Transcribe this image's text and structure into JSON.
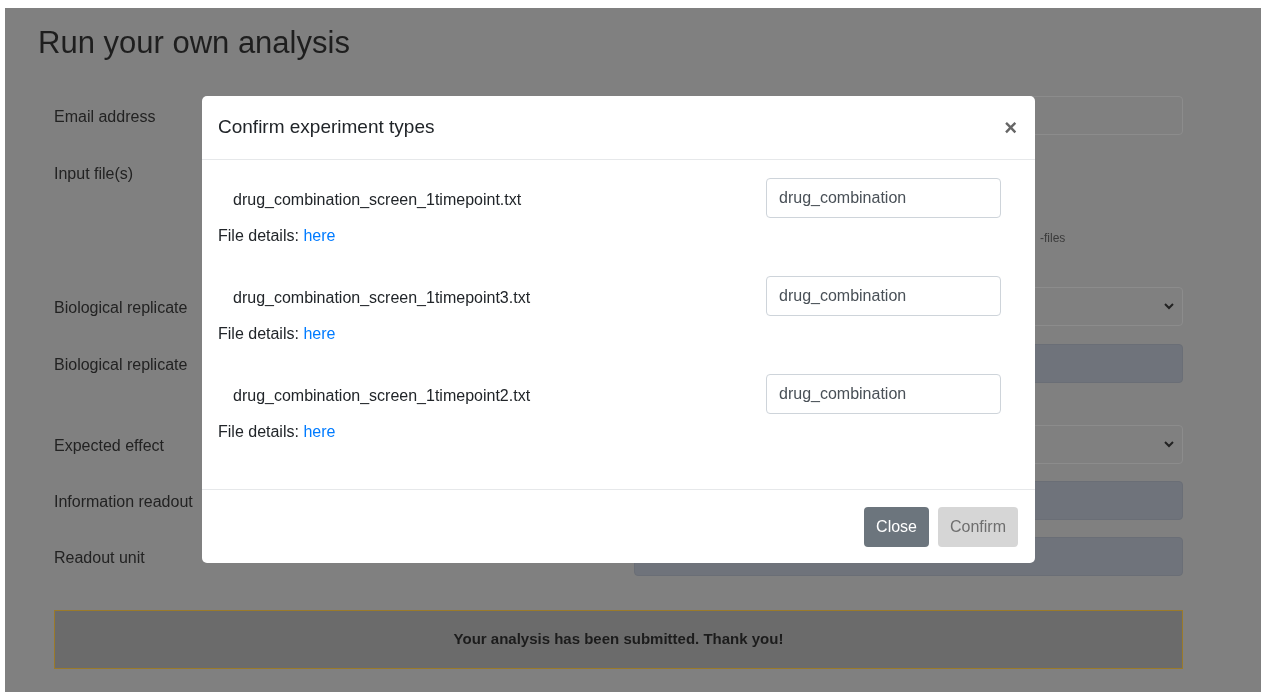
{
  "page": {
    "title": "Run your own analysis",
    "fields": [
      {
        "label": "Email address",
        "kind": "text",
        "disabled": false
      },
      {
        "label": "Input file(s)",
        "kind": "file",
        "note": "-files"
      },
      {
        "label": "Biological replicate",
        "kind": "select",
        "disabled": false
      },
      {
        "label": "Biological replicate",
        "kind": "text",
        "disabled": true
      },
      {
        "label": "Expected effect",
        "kind": "select",
        "disabled": false
      },
      {
        "label": "Information readout",
        "kind": "text",
        "disabled": true
      },
      {
        "label": "Readout unit",
        "kind": "text",
        "disabled": true
      }
    ],
    "alert": "Your analysis has been submitted. Thank you!"
  },
  "dialog": {
    "title": "Confirm experiment types",
    "close": "×",
    "files": [
      {
        "name": "drug_combination_screen_1timepoint.txt",
        "details_label": "File details:",
        "details_link": "here",
        "type_value": "drug_combination"
      },
      {
        "name": "drug_combination_screen_1timepoint3.txt",
        "details_label": "File details:",
        "details_link": "here",
        "type_value": "drug_combination"
      },
      {
        "name": "drug_combination_screen_1timepoint2.txt",
        "details_label": "File details:",
        "details_link": "here",
        "type_value": "drug_combination"
      }
    ],
    "buttons": [
      {
        "label": "Close",
        "disabled": false
      },
      {
        "label": "Confirm",
        "disabled": true
      }
    ]
  }
}
